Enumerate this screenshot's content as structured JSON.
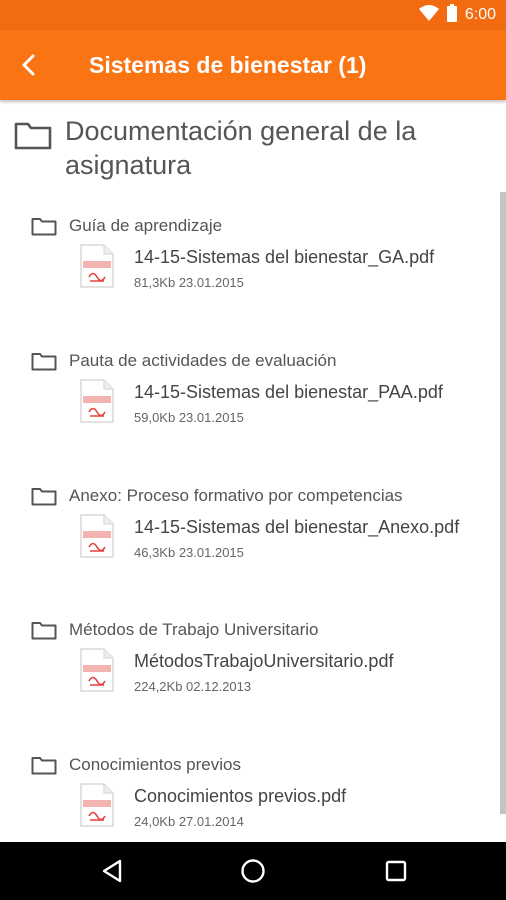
{
  "status_bar": {
    "time": "6:00",
    "icons": [
      "wifi-icon",
      "battery-icon"
    ]
  },
  "app_bar": {
    "title": "Sistemas de bienestar (1)",
    "back_icon": "back-arrow-icon"
  },
  "section": {
    "title": "Documentación general de la asignatura",
    "icon": "folder-icon"
  },
  "groups": [
    {
      "label": "Guía de aprendizaje",
      "file": {
        "name": "14-15-Sistemas del bienestar_GA.pdf",
        "meta": "81,3Kb 23.01.2015"
      }
    },
    {
      "label": "Pauta de actividades de evaluación",
      "file": {
        "name": "14-15-Sistemas del bienestar_PAA.pdf",
        "meta": "59,0Kb 23.01.2015"
      }
    },
    {
      "label": "Anexo: Proceso formativo por competencias",
      "file": {
        "name": "14-15-Sistemas del bienestar_Anexo.pdf",
        "meta": "46,3Kb 23.01.2015"
      }
    },
    {
      "label": "Métodos de Trabajo Universitario",
      "file": {
        "name": "MétodosTrabajoUniversitario.pdf",
        "meta": "224,2Kb 02.12.2013"
      }
    },
    {
      "label": "Conocimientos previos",
      "file": {
        "name": "Conocimientos previos.pdf",
        "meta": "24,0Kb 27.01.2014"
      }
    }
  ],
  "nav_bar": {
    "icons": [
      "back-triangle-icon",
      "home-circle-icon",
      "recents-square-icon"
    ]
  },
  "colors": {
    "status_bar": "#f26b10",
    "app_bar": "#fb7413",
    "pdf_red": "#e8403a",
    "text": "#555555"
  }
}
